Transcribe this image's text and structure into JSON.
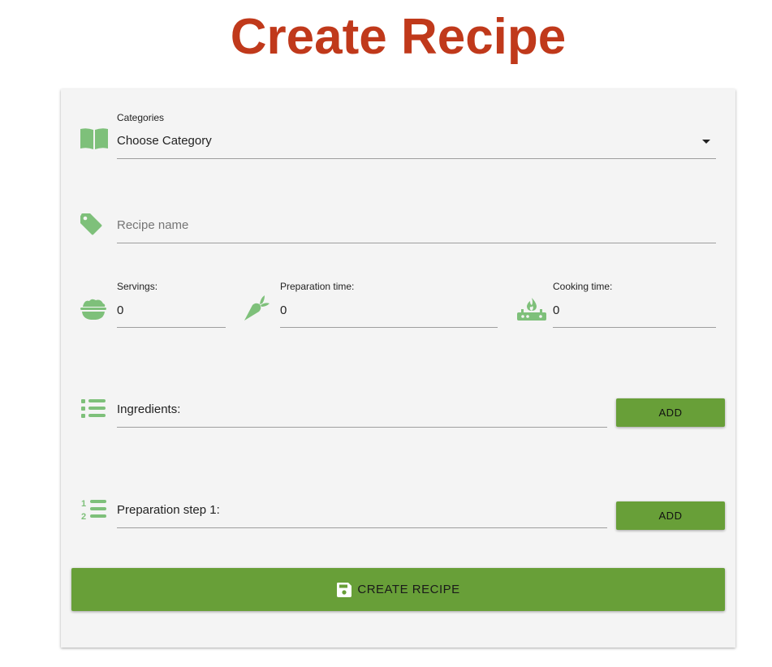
{
  "page": {
    "title": "Create Recipe"
  },
  "form": {
    "category": {
      "label": "Categories",
      "value": "Choose Category",
      "icon": "book-icon"
    },
    "recipe_name": {
      "placeholder": "Recipe name",
      "value": "",
      "icon": "tag-icon"
    },
    "servings": {
      "label": "Servings:",
      "value": "0",
      "icon": "bowl-icon"
    },
    "prep_time": {
      "label": "Preparation time:",
      "value": "0",
      "icon": "carrot-icon"
    },
    "cook_time": {
      "label": "Cooking time:",
      "value": "0",
      "icon": "stove-icon"
    },
    "ingredients": {
      "label": "Ingredients:",
      "icon": "list-icon",
      "add_label": "ADD"
    },
    "prep_step": {
      "label": "Preparation step 1:",
      "icon": "numbered-list-icon",
      "add_label": "ADD"
    },
    "submit": {
      "label": "CREATE RECIPE",
      "icon": "save-icon"
    }
  },
  "colors": {
    "title": "#c0391b",
    "accent": "#689f38",
    "icon": "#7ec07a",
    "card": "#f4f4f4"
  }
}
